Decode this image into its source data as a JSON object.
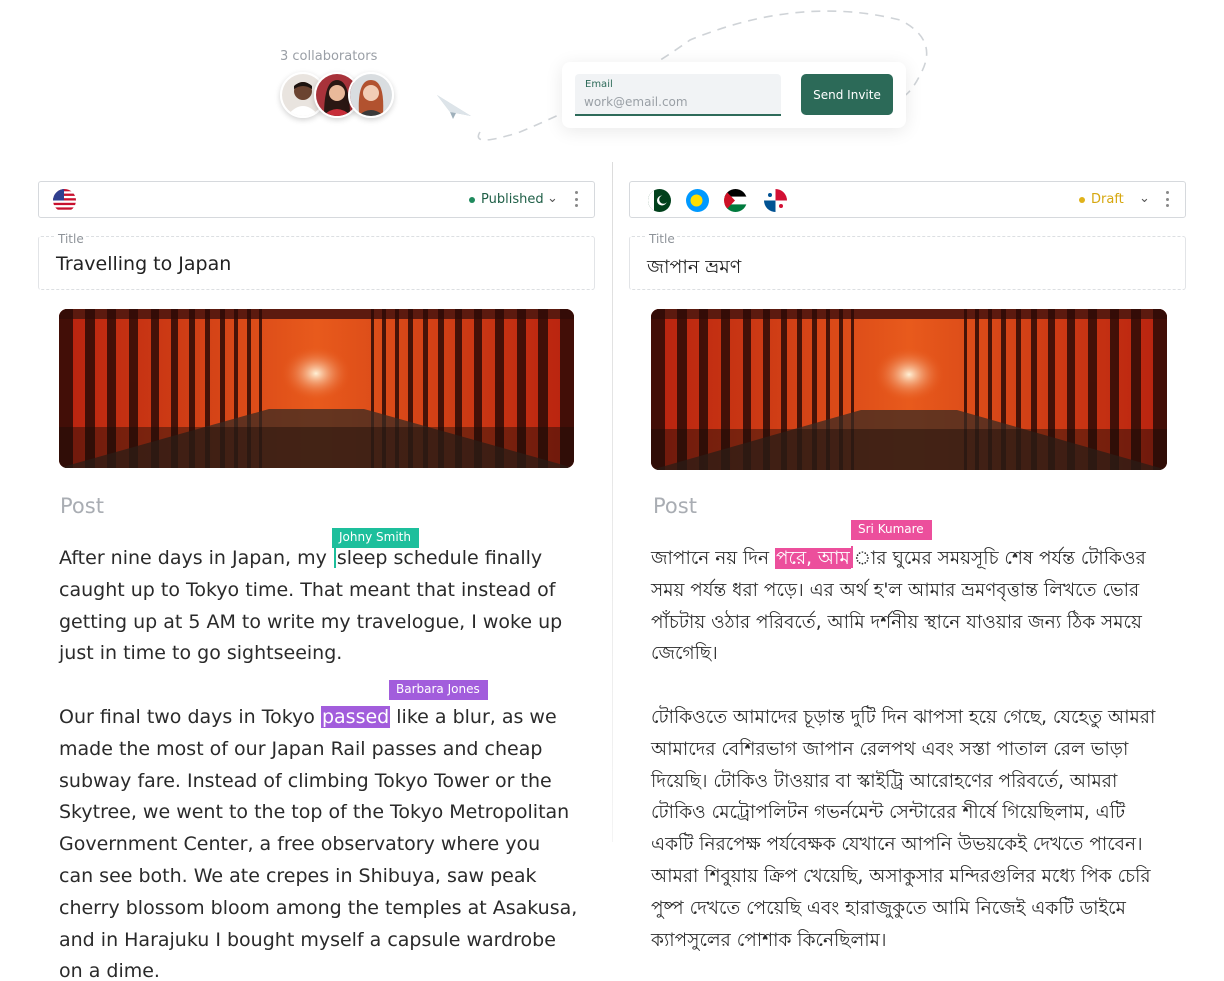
{
  "invite": {
    "collaborators_label": "3 collaborators",
    "email_label": "Email",
    "email_placeholder": "work@email.com",
    "send_label": "Send Invite"
  },
  "left": {
    "status": "Published",
    "status_color": "#1f8a5d",
    "title_label": "Title",
    "title": "Travelling to Japan",
    "post_label": "Post",
    "p1_before": "After nine days in Japan, my ",
    "p1_after": "sleep schedule finally caught up to Tokyo time. That meant that instead of getting up at 5 AM to write my travelogue, I woke up just in time to go sightseeing.",
    "p2_before": "Our final two days in Tokyo ",
    "p2_highlight": "passed",
    "p2_after": " like a blur, as we made the most of our Japan Rail passes and cheap subway fare. Instead of climbing Tokyo Tower or the Skytree, we went to the top of the Tokyo Metropolitan Government Center, a free observatory where you can see both. We ate crepes in Shibuya, saw peak cherry blossom bloom among the temples at Asakusa, and in Harajuku I bought myself a capsule wardrobe on a dime.",
    "cursor1_name": "Johny Smith",
    "cursor2_name": "Barbara Jones",
    "flag": "us-flag"
  },
  "right": {
    "status": "Draft",
    "status_color": "#e0b21a",
    "title_label": "Title",
    "title": "জাপান ভ্রমণ",
    "post_label": "Post",
    "p1_before": "জাপানে নয় দিন ",
    "p1_highlight": "পরে, আম",
    "p1_after": "ার ঘুমের সময়সূচি শেষ পর্যন্ত টোকিওর সময় পর্যন্ত ধরা পড়ে। এর অর্থ হ'ল আমার ভ্রমণবৃত্তান্ত লিখতে ভোর পাঁচটায় ওঠার পরিবর্তে, আমি দর্শনীয় স্থানে যাওয়ার জন্য ঠিক সময়ে জেগেছি।",
    "p2": "টোকিওতে আমাদের চূড়ান্ত দুটি দিন ঝাপসা হয়ে গেছে, যেহেতু আমরা আমাদের বেশিরভাগ জাপান রেলপথ এবং সস্তা পাতাল রেল ভাড়া দিয়েছি। টোকিও টাওয়ার বা স্কাইট্রি আরোহণের পরিবর্তে, আমরা টোকিও মেট্রোপলিটন গভর্নমেন্ট সেন্টারের শীর্ষে গিয়েছিলাম, এটি একটি নিরপেক্ষ পর্যবেক্ষক যেখানে আপনি উভয়কেই দেখতে পাবেন। আমরা শিবুয়ায় ক্রিপ খেয়েছি, অসাকুসার মন্দিরগুলির মধ্যে পিক চেরি পুষ্প দেখতে পেয়েছি এবং হারাজুকুতে আমি নিজেই একটি ডাইমে ক্যাপসুলের পোশাক কিনেছিলাম।",
    "cursor_name": "Sri Kumare",
    "flags": [
      "pakistan-flag",
      "palau-flag",
      "palestine-flag",
      "panama-flag"
    ]
  },
  "colors": {
    "accent": "#2c6a58",
    "teal_cursor": "#1dbf9c",
    "purple_cursor": "#a25ddc",
    "pink_cursor": "#ec4f9c"
  }
}
